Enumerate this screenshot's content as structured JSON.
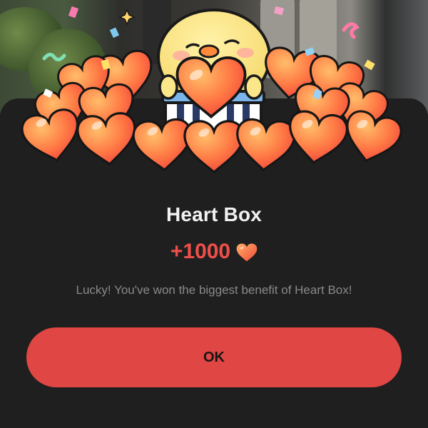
{
  "dialog": {
    "title": "Heart Box",
    "reward_amount": "+1000",
    "reward_icon": "heart-icon",
    "message": "Lucky! You've won the biggest benefit of Heart Box!",
    "ok_label": "OK"
  },
  "colors": {
    "accent": "#df4644",
    "reward_text": "#ef4f4a",
    "sheet_background": "#1f1f1f",
    "title_text": "#f2f2f2",
    "message_text": "#8a8a8a",
    "heart_light": "#ffab5a",
    "heart_dark": "#f2463a",
    "chick_yellow": "#fbe68a"
  },
  "illustration": {
    "icon": "chick-with-hearts-illustration",
    "decorations": [
      "confetti-icon",
      "sparkle-icon"
    ]
  }
}
